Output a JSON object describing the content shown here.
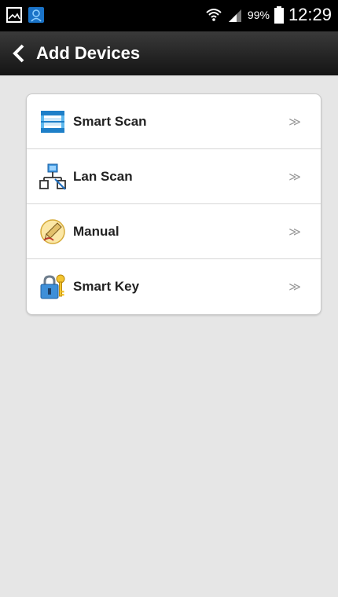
{
  "status_bar": {
    "battery_percent": "99%",
    "time": "12:29"
  },
  "app_bar": {
    "title": "Add Devices"
  },
  "menu": {
    "items": [
      {
        "label": "Smart Scan",
        "icon": "scan-frame-icon",
        "chevron": "≫"
      },
      {
        "label": "Lan Scan",
        "icon": "network-icon",
        "chevron": "≫"
      },
      {
        "label": "Manual",
        "icon": "pencil-icon",
        "chevron": "≫"
      },
      {
        "label": "Smart Key",
        "icon": "lock-key-icon",
        "chevron": "≫"
      }
    ]
  },
  "colors": {
    "background": "#e6e6e6",
    "app_bar": "#1f1f1f",
    "scan_blue": "#1e8fd6",
    "chevron": "#9a9a9a"
  }
}
